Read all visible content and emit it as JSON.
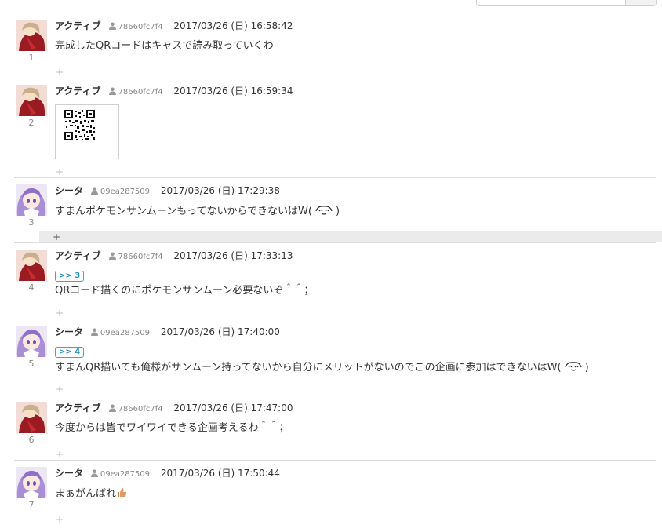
{
  "colors": {
    "divider": "#dcdcdc",
    "reply_badge": "#1f8fc0",
    "highlight_row": "#ebebeb",
    "meta_text": "#888888"
  },
  "posts": [
    {
      "number": "1",
      "name": "アクティブ",
      "uid": "78660fc7f4",
      "date": "2017/03/26 (日) 16:58:42",
      "avatar": "red-character",
      "text": "完成したQRコードはキャスで読み取っていくわ"
    },
    {
      "number": "2",
      "name": "アクティブ",
      "uid": "78660fc7f4",
      "date": "2017/03/26 (日) 16:59:34",
      "avatar": "red-character",
      "image": "qr-code"
    },
    {
      "number": "3",
      "name": "シータ",
      "uid": "09ea287509",
      "date": "2017/03/26 (日) 17:29:38",
      "avatar": "purple-character",
      "text": "すまんポケモンサンムーンもってないからできないはW(",
      "text_tail": ")"
    },
    {
      "number": "4",
      "name": "アクティブ",
      "uid": "78660fc7f4",
      "date": "2017/03/26 (日) 17:33:13",
      "avatar": "red-character",
      "reply_to": ">> 3",
      "text": "QRコード描くのにポケモンサンムーン必要ないぞ＾＾；"
    },
    {
      "number": "5",
      "name": "シータ",
      "uid": "09ea287509",
      "date": "2017/03/26 (日) 17:40:00",
      "avatar": "purple-character",
      "reply_to": ">> 4",
      "text": "すまんQR描いても俺様がサンムーン持ってないから自分にメリットがないのでこの企画に参加はできないはW(",
      "text_tail": ")"
    },
    {
      "number": "6",
      "name": "アクティブ",
      "uid": "78660fc7f4",
      "date": "2017/03/26 (日) 17:47:00",
      "avatar": "red-character",
      "text": "今度からは皆でワイワイできる企画考えるわ＾＾；"
    },
    {
      "number": "7",
      "name": "シータ",
      "uid": "09ea287509",
      "date": "2017/03/26 (日) 17:50:44",
      "avatar": "purple-character",
      "text": "まぁがんばれ"
    }
  ],
  "add_reply_symbol": "+"
}
